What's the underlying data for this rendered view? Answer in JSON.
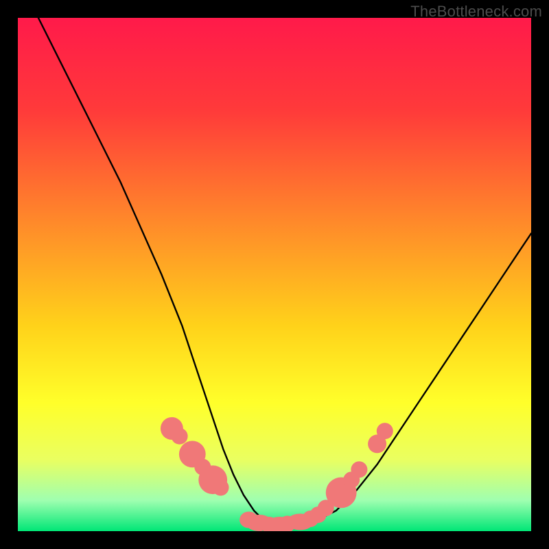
{
  "watermark": "TheBottleneck.com",
  "gradient": {
    "stops": [
      {
        "offset": 0.0,
        "color": "#ff1a4a"
      },
      {
        "offset": 0.18,
        "color": "#ff3a3a"
      },
      {
        "offset": 0.4,
        "color": "#ff8a2a"
      },
      {
        "offset": 0.6,
        "color": "#ffd21a"
      },
      {
        "offset": 0.75,
        "color": "#ffff2a"
      },
      {
        "offset": 0.86,
        "color": "#eaff60"
      },
      {
        "offset": 0.94,
        "color": "#9fffb0"
      },
      {
        "offset": 1.0,
        "color": "#00e676"
      }
    ]
  },
  "chart_data": {
    "type": "line",
    "title": "",
    "xlabel": "",
    "ylabel": "",
    "xlim": [
      0,
      100
    ],
    "ylim": [
      0,
      100
    ],
    "series": [
      {
        "name": "curve",
        "x": [
          4,
          8,
          12,
          16,
          20,
          24,
          28,
          30,
          32,
          34,
          36,
          38,
          40,
          42,
          44,
          46,
          48,
          50,
          52,
          55,
          58,
          62,
          66,
          70,
          74,
          78,
          82,
          86,
          90,
          94,
          98,
          100
        ],
        "y": [
          100,
          92,
          84,
          76,
          68,
          59,
          50,
          45,
          40,
          34,
          28,
          22,
          16,
          11,
          7,
          4,
          2,
          1,
          1,
          1,
          2,
          4,
          8,
          13,
          19,
          25,
          31,
          37,
          43,
          49,
          55,
          58
        ]
      }
    ],
    "markers": {
      "name": "highlight-dots",
      "color": "#f07878",
      "x": [
        30,
        31.5,
        34,
        36,
        38,
        39.5,
        45,
        47,
        49,
        51,
        52.5,
        55,
        57,
        58.5,
        60,
        63,
        65,
        66.5,
        70,
        71.5
      ],
      "y": [
        20,
        18.5,
        15,
        12.5,
        10,
        8.5,
        2.2,
        1.6,
        1.2,
        1.2,
        1.4,
        1.8,
        2.4,
        3.2,
        4.5,
        7.5,
        10,
        12,
        17,
        19.5
      ],
      "rx": [
        2.2,
        1.6,
        2.6,
        1.6,
        2.8,
        1.6,
        1.8,
        2.6,
        1.6,
        2.6,
        1.6,
        2.6,
        1.6,
        1.6,
        1.6,
        3.0,
        1.6,
        1.6,
        1.8,
        1.6
      ],
      "ry": [
        2.2,
        1.6,
        2.6,
        1.6,
        2.8,
        1.6,
        1.6,
        1.6,
        1.6,
        1.6,
        1.6,
        1.6,
        1.6,
        1.6,
        1.6,
        3.0,
        1.6,
        1.6,
        1.8,
        1.6
      ]
    }
  }
}
